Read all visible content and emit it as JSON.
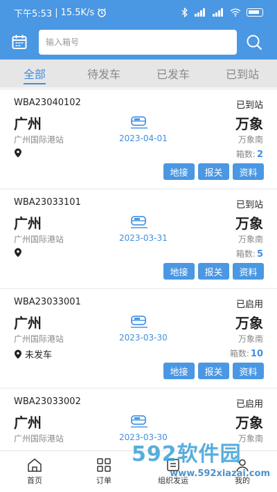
{
  "status_bar": {
    "time": "下午5:53",
    "speed": "15.5K/s"
  },
  "search": {
    "placeholder": "输入箱号"
  },
  "tabs": [
    {
      "label": "全部",
      "active": true
    },
    {
      "label": "待发车",
      "active": false
    },
    {
      "label": "已发车",
      "active": false
    },
    {
      "label": "已到站",
      "active": false
    }
  ],
  "orders": [
    {
      "id": "WBA23040102",
      "status": "已到站",
      "from": "广州",
      "from_station": "广州国际港站",
      "date": "2023-04-01",
      "to": "万象",
      "to_station": "万象南",
      "location": "",
      "count_label": "箱数:",
      "count": "2"
    },
    {
      "id": "WBA23033101",
      "status": "已到站",
      "from": "广州",
      "from_station": "广州国际港站",
      "date": "2023-03-31",
      "to": "万象",
      "to_station": "万象南",
      "location": "",
      "count_label": "箱数:",
      "count": "5"
    },
    {
      "id": "WBA23033001",
      "status": "已启用",
      "from": "广州",
      "from_station": "广州国际港站",
      "date": "2023-03-30",
      "to": "万象",
      "to_station": "万象南",
      "location": "未发车",
      "count_label": "箱数:",
      "count": "10"
    },
    {
      "id": "WBA23033002",
      "status": "已启用",
      "from": "广州",
      "from_station": "广州国际港站",
      "date": "2023-03-30",
      "to": "万象",
      "to_station": "万象南",
      "location": "",
      "count_label": "",
      "count": ""
    }
  ],
  "card_buttons": [
    "地接",
    "报关",
    "资料"
  ],
  "bottom_nav": [
    {
      "label": "首页",
      "icon": "home-icon"
    },
    {
      "label": "订单",
      "icon": "grid-icon"
    },
    {
      "label": "组织发运",
      "icon": "dispatch-icon"
    },
    {
      "label": "我的",
      "icon": "user-icon"
    }
  ],
  "watermark": {
    "logo": "592软件园",
    "url": "www.592xiazai.com"
  },
  "colors": {
    "primary": "#4a97e3",
    "accent_text": "#3f8fe0"
  }
}
